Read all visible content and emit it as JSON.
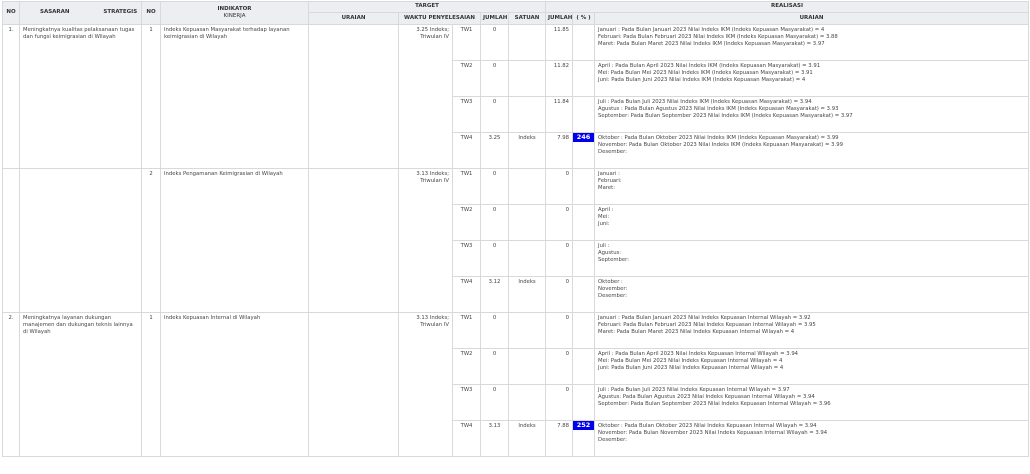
{
  "header": {
    "no": "NO",
    "sasaran": "SASARAN",
    "strategis": "STRATEGIS",
    "no2": "NO",
    "indikator_line1": "INDIKATOR",
    "indikator_line2": "KINERJA",
    "target": "TARGET",
    "uraian": "URAIAN",
    "waktu": "WAKTU PENYELESAIAN",
    "jumlah": "JUMLAH",
    "satuan": "SATUAN",
    "realisasi": "REALISASI",
    "r_jumlah": "JUMLAH",
    "r_pct": "( % )",
    "r_uraian": "URAIAN"
  },
  "rows": [
    {
      "no": "1.",
      "sasaran": "Meningkatnya kualitas pelaksanaan tugas dan fungsi keimigrasian di Wilayah",
      "ind_no": "1",
      "indikator": "Indeks Kepuasan Masyarakat terhadap layanan keimigrasian di Wilayah",
      "waktu": "3.25 Indeks; Triwulan IV",
      "quarters": [
        {
          "tw": "TW1",
          "jumlah": "0",
          "satuan": "",
          "r_jumlah": "11.85",
          "pct": "",
          "pct_color": "grey",
          "lines": [
            "Januari : Pada Bulan Januari 2023 Nilai Indeks IKM (Indeks Kepuasan Masyarakat) = 4",
            "Februari: Pada Bulan Februari 2023 Nilai Indeks IKM (Indeks Kepuasan Masyarakat) = 3.88",
            "Maret: Pada Bulan Maret 2023 Nilai Indeks IKM (Indeks Kepuasan Masyarakat) = 3.97"
          ]
        },
        {
          "tw": "TW2",
          "jumlah": "0",
          "satuan": "",
          "r_jumlah": "11.82",
          "pct": "",
          "pct_color": "grey",
          "lines": [
            "April : Pada Bulan April 2023 Nilai Indeks IKM (Indeks Kepuasan Masyarakat) = 3.91",
            "Mei: Pada Bulan Mei 2023 Nilai Indeks IKM (Indeks Kepuasan Masyarakat) = 3.91",
            "Juni: Pada Bulan Juni 2023 Nilai Indeks IKM (Indeks Kepuasan Masyarakat) = 4"
          ]
        },
        {
          "tw": "TW3",
          "jumlah": "0",
          "satuan": "",
          "r_jumlah": "11.84",
          "pct": "",
          "pct_color": "grey",
          "lines": [
            "Juli : Pada Bulan Juli 2023 Nilai Indeks IKM (Indeks Kepuasan Masyarakat) = 3.94",
            "Agustus : Pada Bulan Agustus 2023 Nilai Indeks IKM (Indeks Kepuasan Masyarakat) = 3.93",
            "September: Pada Bulan September 2023 Nilai Indeks IKM (Indeks Kepuasan Masyarakat) = 3.97"
          ]
        },
        {
          "tw": "TW4",
          "jumlah": "3.25",
          "satuan": "Indeks",
          "r_jumlah": "7.98",
          "pct": "246",
          "pct_color": "blue",
          "lines": [
            "Oktober : Pada Bulan Oktober 2023 Nilai Indeks IKM (Indeks Kepuasan Masyarakat) = 3.99",
            "November: Pada Bulan Oktober 2023 Nilai Indeks IKM (Indeks Kepuasan Masyarakat) = 3.99",
            "Desember:"
          ]
        }
      ]
    },
    {
      "no": "",
      "sasaran": "",
      "ind_no": "2",
      "indikator": "Indeks Pengamanan Keimigrasian di Wilayah",
      "waktu": "3.13 Indeks; Triwulan IV",
      "quarters": [
        {
          "tw": "TW1",
          "jumlah": "0",
          "satuan": "",
          "r_jumlah": "0",
          "pct": "",
          "pct_color": "grey",
          "lines": [
            "Januari :",
            "Februari:",
            "Maret:"
          ]
        },
        {
          "tw": "TW2",
          "jumlah": "0",
          "satuan": "",
          "r_jumlah": "0",
          "pct": "",
          "pct_color": "grey",
          "lines": [
            "April :",
            "Mei:",
            "Juni:"
          ]
        },
        {
          "tw": "TW3",
          "jumlah": "0",
          "satuan": "",
          "r_jumlah": "0",
          "pct": "",
          "pct_color": "grey",
          "lines": [
            "Juli :",
            "Agustus:",
            "September:"
          ]
        },
        {
          "tw": "TW4",
          "jumlah": "3.12",
          "satuan": "Indeks",
          "r_jumlah": "0",
          "pct": "",
          "pct_color": "red",
          "lines": [
            "Oktober :",
            "November:",
            "Desember:"
          ]
        }
      ]
    },
    {
      "no": "2.",
      "sasaran": "Meningkatnya layanan dukungan manajemen dan dukungan teknis lainnya di Wilayah",
      "ind_no": "1",
      "indikator": "Indeks Kepuasan Internal di Wilayah",
      "waktu": "3.13 Indeks; Triwulan IV",
      "quarters": [
        {
          "tw": "TW1",
          "jumlah": "0",
          "satuan": "",
          "r_jumlah": "0",
          "pct": "",
          "pct_color": "grey",
          "lines": [
            "Januari : Pada Bulan Januari 2023 Nilai Indeks Kepuasan Internal Wilayah = 3.92",
            "Februari: Pada Bulan Februari 2023 Nilai Indeks Kepuasan Internal Wilayah = 3.95",
            "Maret: Pada Bulan Maret 2023 Nilai Indeks Kepuasan Internal Wilayah = 4"
          ]
        },
        {
          "tw": "TW2",
          "jumlah": "0",
          "satuan": "",
          "r_jumlah": "0",
          "pct": "",
          "pct_color": "grey",
          "lines": [
            "April : Pada Bulan April 2023 Nilai Indeks Kepuasan Internal Wilayah = 3.94",
            "Mei: Pada Bulan Mei 2023 Nilai Indeks Kepuasan Internal Wilayah = 4",
            "Juni: Pada Bulan Juni 2023 Nilai Indeks Kepuasan Internal Wilayah = 4"
          ]
        },
        {
          "tw": "TW3",
          "jumlah": "0",
          "satuan": "",
          "r_jumlah": "0",
          "pct": "",
          "pct_color": "grey",
          "lines": [
            "Juli : Pada Bulan Juli 2023 Nilai Indeks Kepuasan Internal Wilayah = 3.97",
            "Agustus: Pada Bulan Agustus 2023 Nilai Indeks Kepuasan Internal Wilayah = 3.94",
            "September: Pada Bulan September 2023 Nilai Indeks Kepuasan Internal Wilayah = 3.96"
          ]
        },
        {
          "tw": "TW4",
          "jumlah": "3.13",
          "satuan": "Indeks",
          "r_jumlah": "7.88",
          "pct": "252",
          "pct_color": "blue",
          "lines": [
            "Oktober : Pada Bulan Oktober 2023 Nilai Indeks Kepuasan Internal Wilayah = 3.94",
            "November: Pada Bulan November 2023 Nilai Indeks Kepuasan Internal Wilayah = 3.94",
            "Desember:"
          ]
        }
      ]
    }
  ]
}
